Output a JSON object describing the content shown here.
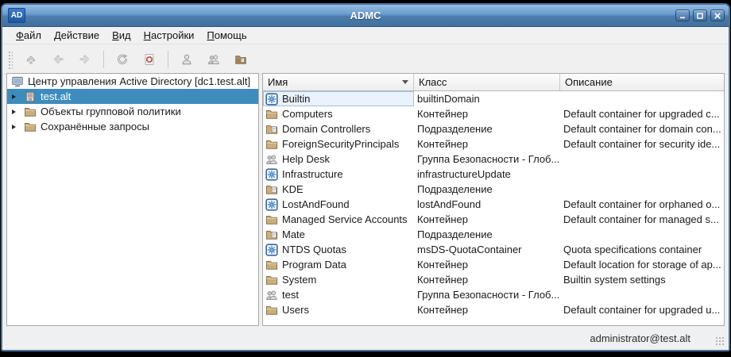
{
  "window": {
    "title": "ADMC",
    "icon_text": "AD",
    "controls": [
      {
        "name": "minimize",
        "icon": "minimize-icon"
      },
      {
        "name": "maximize",
        "icon": "maximize-icon"
      },
      {
        "name": "close",
        "icon": "close-icon"
      }
    ]
  },
  "menu": {
    "items": [
      {
        "id": "file",
        "label": "Файл"
      },
      {
        "id": "action",
        "label": "Действие"
      },
      {
        "id": "view",
        "label": "Вид"
      },
      {
        "id": "settings",
        "label": "Настройки"
      },
      {
        "id": "help",
        "label": "Помощь"
      }
    ]
  },
  "toolbar": {
    "buttons": [
      {
        "kind": "button",
        "name": "navigate-up",
        "icon": "up-arrow",
        "enabled": true
      },
      {
        "kind": "button",
        "name": "navigate-back",
        "icon": "back-arrow",
        "enabled": false
      },
      {
        "kind": "button",
        "name": "navigate-forward",
        "icon": "forward-arrow",
        "enabled": false
      },
      {
        "kind": "separator"
      },
      {
        "kind": "button",
        "name": "refresh",
        "icon": "refresh",
        "enabled": true
      },
      {
        "kind": "button",
        "name": "query",
        "icon": "query-target",
        "enabled": true
      },
      {
        "kind": "separator"
      },
      {
        "kind": "button",
        "name": "create-user",
        "icon": "user",
        "enabled": true
      },
      {
        "kind": "button",
        "name": "create-group",
        "icon": "users",
        "enabled": true
      },
      {
        "kind": "button",
        "name": "create-ou",
        "icon": "folder-new",
        "enabled": true
      }
    ]
  },
  "tree": {
    "root_label": "Центр управления Active Directory [dc1.test.alt]",
    "items": [
      {
        "icon": "domain",
        "label": "test.alt",
        "selected": true
      },
      {
        "icon": "folder",
        "label": "Объекты групповой политики",
        "selected": false
      },
      {
        "icon": "folder",
        "label": "Сохранённые запросы",
        "selected": false
      }
    ]
  },
  "table": {
    "columns": [
      {
        "id": "name",
        "label": "Имя",
        "sort": "down"
      },
      {
        "id": "class",
        "label": "Класс"
      },
      {
        "id": "description",
        "label": "Описание"
      }
    ],
    "rows": [
      {
        "icon": "special",
        "name": "Builtin",
        "class": "builtinDomain",
        "description": "",
        "current": true
      },
      {
        "icon": "folder",
        "name": "Computers",
        "class": "Контейнер",
        "description": "Default container for upgraded c...",
        "current": false
      },
      {
        "icon": "ou",
        "name": "Domain Controllers",
        "class": "Подразделение",
        "description": "Default container for domain con...",
        "current": false
      },
      {
        "icon": "folder",
        "name": "ForeignSecurityPrincipals",
        "class": "Контейнер",
        "description": "Default container for security ide...",
        "current": false
      },
      {
        "icon": "group",
        "name": "Help Desk",
        "class": "Группа Безопасности - Глоб...",
        "description": "",
        "current": false
      },
      {
        "icon": "special",
        "name": "Infrastructure",
        "class": "infrastructureUpdate",
        "description": "",
        "current": false
      },
      {
        "icon": "ou",
        "name": "KDE",
        "class": "Подразделение",
        "description": "",
        "current": false
      },
      {
        "icon": "special",
        "name": "LostAndFound",
        "class": "lostAndFound",
        "description": "Default container for orphaned o...",
        "current": false
      },
      {
        "icon": "folder",
        "name": "Managed Service Accounts",
        "class": "Контейнер",
        "description": "Default container for managed s...",
        "current": false
      },
      {
        "icon": "ou",
        "name": "Mate",
        "class": "Подразделение",
        "description": "",
        "current": false
      },
      {
        "icon": "special",
        "name": "NTDS Quotas",
        "class": "msDS-QuotaContainer",
        "description": "Quota specifications container",
        "current": false
      },
      {
        "icon": "folder",
        "name": "Program Data",
        "class": "Контейнер",
        "description": "Default location for storage of ap...",
        "current": false
      },
      {
        "icon": "folder",
        "name": "System",
        "class": "Контейнер",
        "description": "Builtin system settings",
        "current": false
      },
      {
        "icon": "group",
        "name": "test",
        "class": "Группа Безопасности - Глоб...",
        "description": "",
        "current": false
      },
      {
        "icon": "folder",
        "name": "Users",
        "class": "Контейнер",
        "description": "Default container for upgraded u...",
        "current": false
      }
    ]
  },
  "statusbar": {
    "user": "administrator@test.alt"
  },
  "colors": {
    "titlebar_top": "#93bbe2",
    "titlebar_bottom": "#3f6f9e",
    "selection": "#3e8cbe",
    "folder": "#c9ae80",
    "accent_red": "#c23b3b"
  }
}
